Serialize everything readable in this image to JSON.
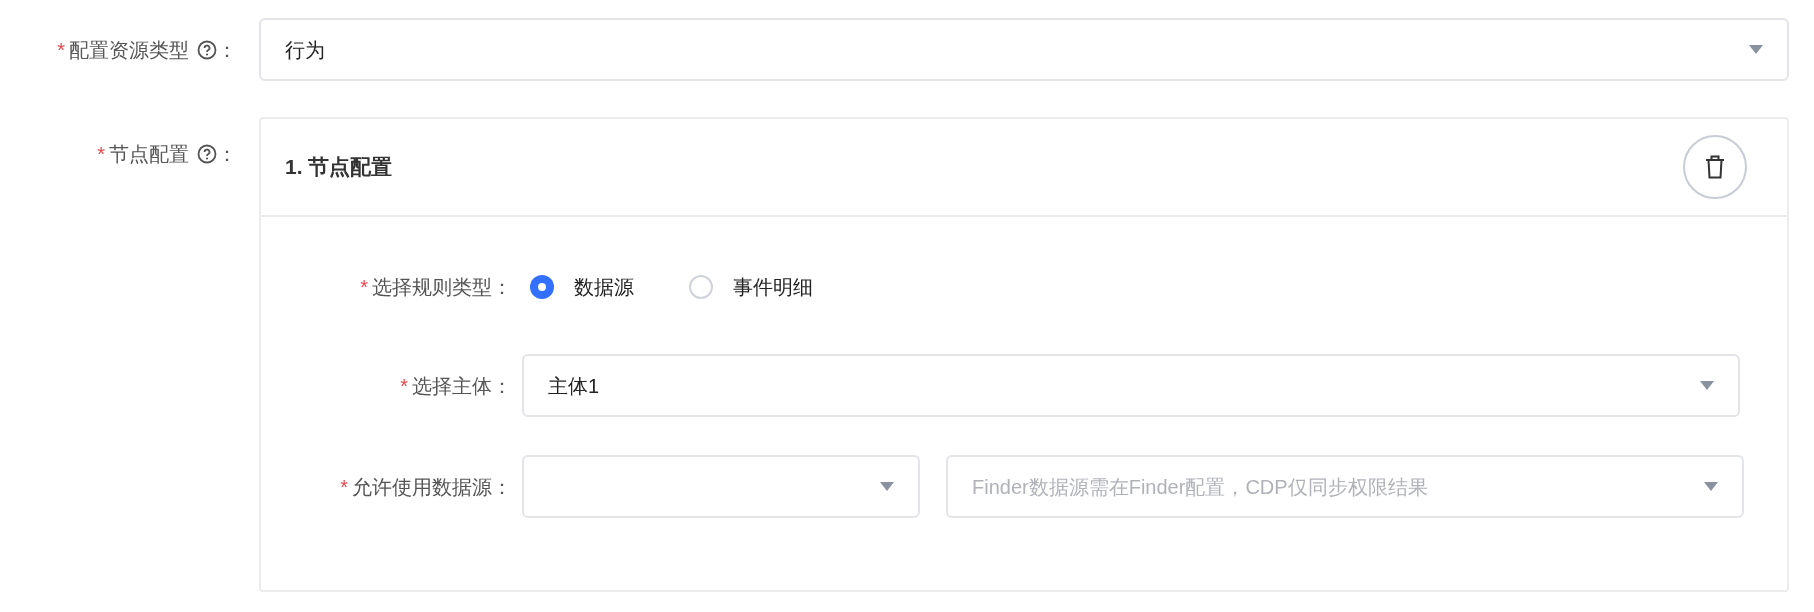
{
  "resource_type": {
    "required_mark": "*",
    "label": "配置资源类型",
    "help": true,
    "colon": "：",
    "value": "行为"
  },
  "node_config": {
    "required_mark": "*",
    "label": "节点配置",
    "help": true,
    "colon": "：",
    "nodes": [
      {
        "title": "1. 节点配置",
        "rule_type": {
          "required_mark": "*",
          "label": "选择规则类型",
          "colon": "：",
          "options": [
            {
              "label": "数据源",
              "selected": true
            },
            {
              "label": "事件明细",
              "selected": false
            }
          ]
        },
        "subject": {
          "required_mark": "*",
          "label": "选择主体",
          "colon": "：",
          "value": "主体1"
        },
        "data_source": {
          "required_mark": "*",
          "label": "允许使用数据源",
          "colon": "：",
          "placeholder": "Finder数据源需在Finder配置，CDP仅同步权限结果"
        }
      }
    ]
  }
}
